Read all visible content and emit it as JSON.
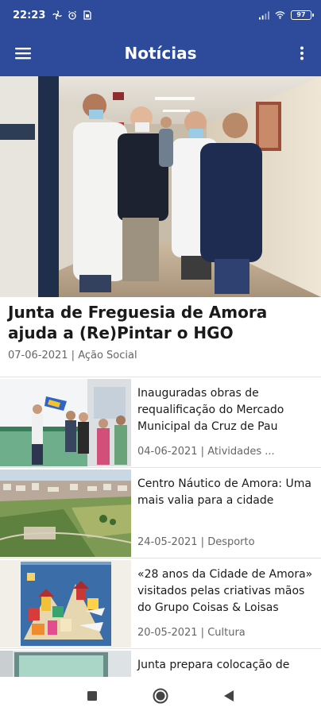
{
  "status_bar": {
    "time": "22:23",
    "battery": "97",
    "icons": [
      "fan-icon",
      "alarm-icon",
      "sim-icon",
      "signal-icon",
      "wifi-icon",
      "battery-icon"
    ]
  },
  "app_bar": {
    "title": "Notícias",
    "color": "#2d4a9b",
    "icons": [
      "hamburger-menu-icon",
      "more-vert-icon"
    ]
  },
  "featured": {
    "title": "Junta de Freguesia de Amora ajuda a (Re)Pintar o HGO",
    "date": "07-06-2021",
    "category": "Ação Social",
    "meta": "07-06-2021 | Ação Social"
  },
  "news": [
    {
      "title": "Inauguradas obras de requalificação do Mercado Municipal da Cruz de Pau",
      "date": "04-06-2021",
      "category": "Atividades ...",
      "meta": "04-06-2021 | Atividades ..."
    },
    {
      "title": "Centro Náutico de Amora: Uma mais valia para  a cidade",
      "date": "24-05-2021",
      "category": "Desporto",
      "meta": "24-05-2021 | Desporto"
    },
    {
      "title": "«28 anos da Cidade de Amora» visitados pelas criativas mãos do Grupo Coisas & Loisas",
      "date": "20-05-2021",
      "category": "Cultura",
      "meta": "20-05-2021 | Cultura"
    },
    {
      "title": "Junta prepara colocação de",
      "date": "",
      "category": "",
      "meta": ""
    }
  ],
  "nav_bar": {
    "icons": [
      "recents-icon",
      "home-icon",
      "back-icon"
    ]
  }
}
